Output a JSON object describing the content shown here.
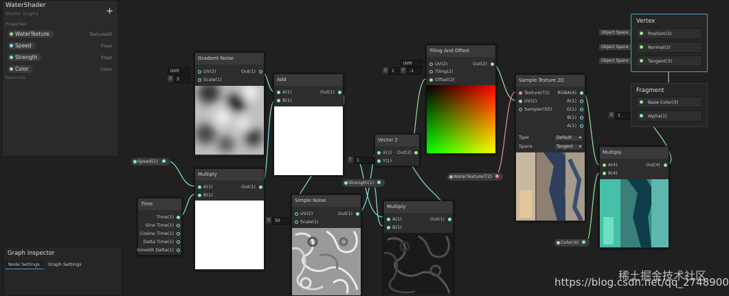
{
  "blackboard": {
    "title": "WaterShader",
    "subtitle": "Shader Graphs",
    "add_symbol": "+",
    "properties_label": "Properties",
    "keywords_label": "Keywords",
    "properties": [
      {
        "name": "WaterTexture",
        "type": "Texture2D"
      },
      {
        "name": "Speed",
        "type": "Float"
      },
      {
        "name": "Strength",
        "type": "Float"
      },
      {
        "name": "Color",
        "type": "Color"
      }
    ]
  },
  "inspector": {
    "title": "Graph Inspector",
    "tabs": [
      "Node Settings",
      "Graph Settings"
    ]
  },
  "nodes": {
    "gradient_noise": {
      "title": "Gradient Noise",
      "inputs": [
        "UV(2)",
        "Scale(1)"
      ],
      "outputs": [
        "Out(1)"
      ],
      "uv_value": "UV0",
      "scale_label": "X",
      "scale_value": "3"
    },
    "add": {
      "title": "Add",
      "inputs": [
        "A(1)",
        "B(1)"
      ],
      "outputs": [
        "Out(1)"
      ]
    },
    "multiply1": {
      "title": "Multiply",
      "inputs": [
        "A(1)",
        "B(1)"
      ],
      "outputs": [
        "Out(1)"
      ]
    },
    "time": {
      "title": "Time",
      "outputs": [
        "Time(1)",
        "Sine Time(1)",
        "Cosine Time(1)",
        "Delta Time(1)",
        "Smooth Delta(1)"
      ]
    },
    "simple_noise": {
      "title": "Simple Noise",
      "inputs": [
        "UV(2)",
        "Scale(1)"
      ],
      "outputs": [
        "Out(1)"
      ],
      "scale_label": "X",
      "scale_value": "50"
    },
    "vector2": {
      "title": "Vector 2",
      "inputs": [
        "X(1)",
        "Y(1)"
      ],
      "outputs": [
        "Out(2)"
      ],
      "y_label": "Y",
      "y_value": "1"
    },
    "multiply2": {
      "title": "Multiply",
      "inputs": [
        "A(1)",
        "B(1)"
      ],
      "outputs": [
        "Out(1)"
      ]
    },
    "tiling_offset": {
      "title": "Tiling And Offset",
      "inputs": [
        "UV(2)",
        "Tiling(2)",
        "Offset(2)"
      ],
      "outputs": [
        "Out(2)"
      ],
      "uv_value": "UV0",
      "tx_label": "X",
      "tx_value": "1",
      "ty_label": "Y",
      "ty_value": "-1"
    },
    "sample_texture": {
      "title": "Sample Texture 2D",
      "inputs": [
        "Texture(T2)",
        "UV(2)",
        "Sampler(SS)"
      ],
      "outputs": [
        "RGBA(4)",
        "R(1)",
        "G(1)",
        "B(1)",
        "A(1)"
      ],
      "type_label": "Type",
      "type_value": "Default",
      "space_label": "Space",
      "space_value": "Tangent"
    },
    "multiply3": {
      "title": "Multiply",
      "inputs": [
        "A(4)",
        "B(4)"
      ],
      "outputs": [
        "Out(4)"
      ]
    }
  },
  "property_pills": {
    "speed": "Speed(1)",
    "strength": "Strength(1)",
    "water_texture": "WaterTexture(T2)",
    "color": "Color(4)"
  },
  "vertex": {
    "title": "Vertex",
    "rows": [
      {
        "space": "Object Space",
        "label": "Position(3)"
      },
      {
        "space": "Object Space",
        "label": "Normal(3)"
      },
      {
        "space": "Object Space",
        "label": "Tangent(3)"
      }
    ]
  },
  "fragment": {
    "title": "Fragment",
    "rows": [
      {
        "label": "Base Color(3)"
      },
      {
        "label": "Alpha(1)"
      }
    ],
    "alpha_label": "X",
    "alpha_value": "1"
  },
  "watermark": {
    "line1": "稀土掘金技术社区",
    "line2": "https://blog.csdn.net/qq_27489007"
  },
  "colors": {
    "float_port": "#84e4e7",
    "vector_port": "#9be29b",
    "texture_port": "#f08aa0",
    "wire_float": "#84e4e7",
    "wire_vector": "#9be29b",
    "wire_texture": "#f08aa0",
    "master_border": "#4aa3c8"
  }
}
